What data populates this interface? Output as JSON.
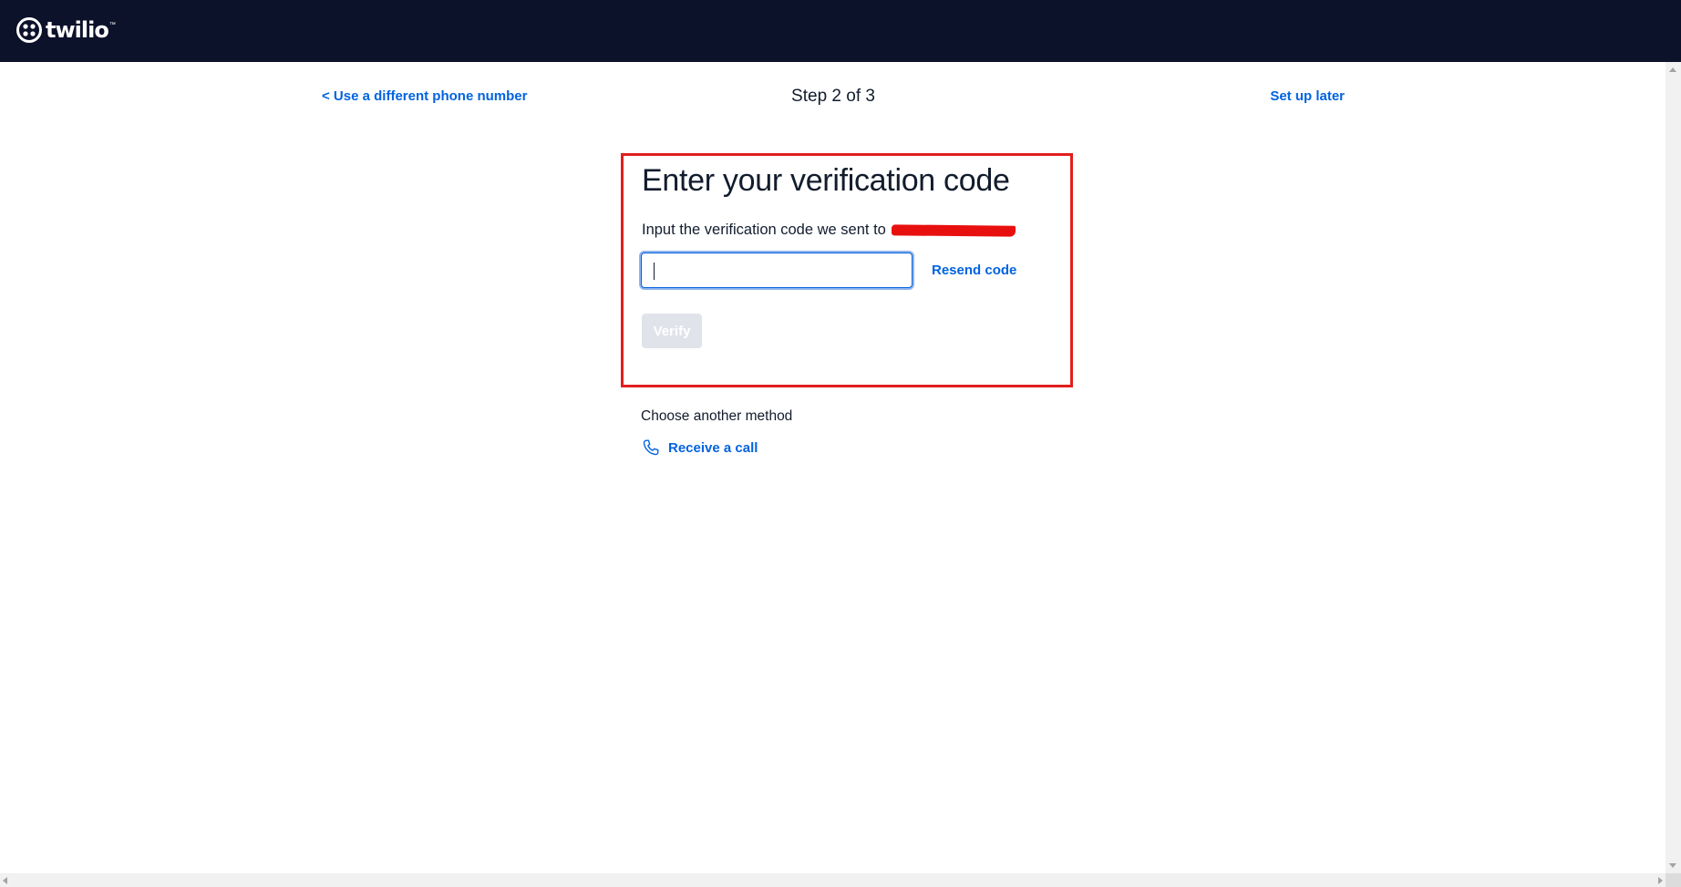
{
  "header": {
    "logo_text": "twilio",
    "logo_tm": "™",
    "brand_color": "#0d122b"
  },
  "stepper": {
    "back_link": "< Use a different phone number",
    "step_text": "Step 2 of 3",
    "skip_link": "Set up later"
  },
  "verification": {
    "title": "Enter your verification code",
    "description": "Input the verification code we sent to",
    "code_value": "",
    "resend_label": "Resend code",
    "verify_label": "Verify"
  },
  "alternate": {
    "heading": "Choose another method",
    "methods": [
      {
        "icon": "phone-icon",
        "label": "Receive a call"
      }
    ]
  },
  "colors": {
    "link": "#0263e0",
    "highlight_border": "#e31e1e",
    "redaction": "#e8100f",
    "disabled_button": "#e1e3ea"
  }
}
